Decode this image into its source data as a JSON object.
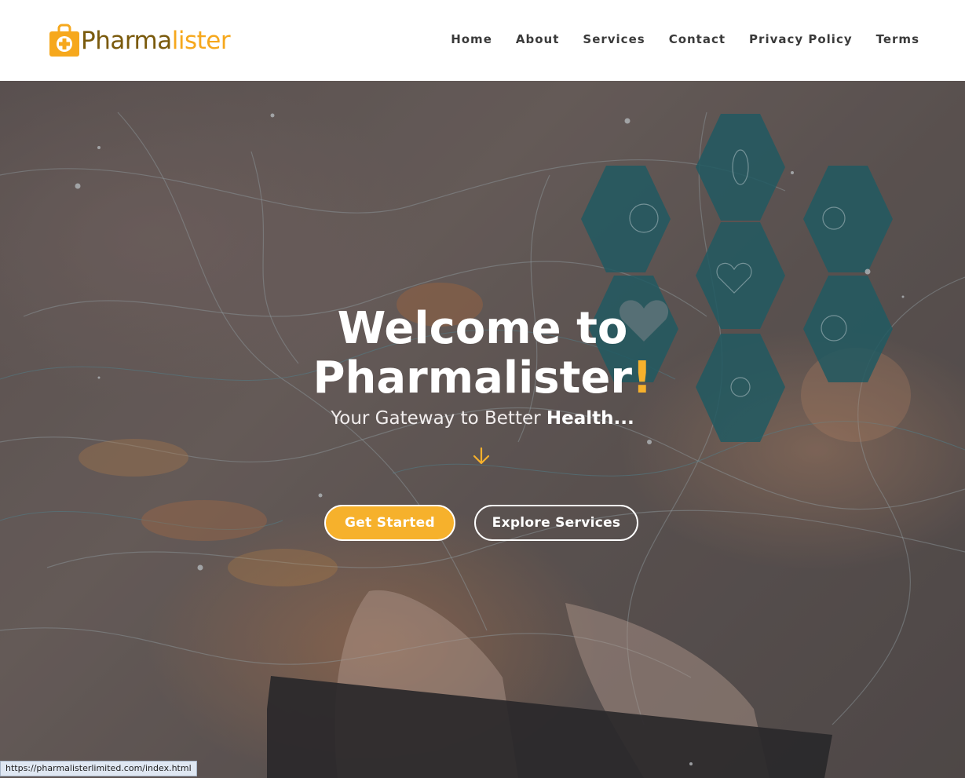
{
  "brand": {
    "name_part1": "Pharma",
    "name_part2": "lister",
    "primary_color": "#7a5a0c",
    "accent_color": "#f6a81d",
    "icon": "medical-bag-plus-icon"
  },
  "nav": {
    "items": [
      {
        "label": "Home"
      },
      {
        "label": "About"
      },
      {
        "label": "Services"
      },
      {
        "label": "Contact"
      },
      {
        "label": "Privacy Policy"
      },
      {
        "label": "Terms"
      }
    ]
  },
  "hero": {
    "title_line1": "Welcome to",
    "title_line2": "Pharmalister",
    "title_punct": "!",
    "subtitle_regular": "Your Gateway to Better",
    "subtitle_bold": "Health...",
    "scroll_icon": "arrow-down-icon",
    "primary_button": "Get Started",
    "secondary_button": "Explore Services",
    "accent_color": "#f6b12c"
  },
  "status_bar": {
    "url": "https://pharmalisterlimited.com/index.html"
  }
}
